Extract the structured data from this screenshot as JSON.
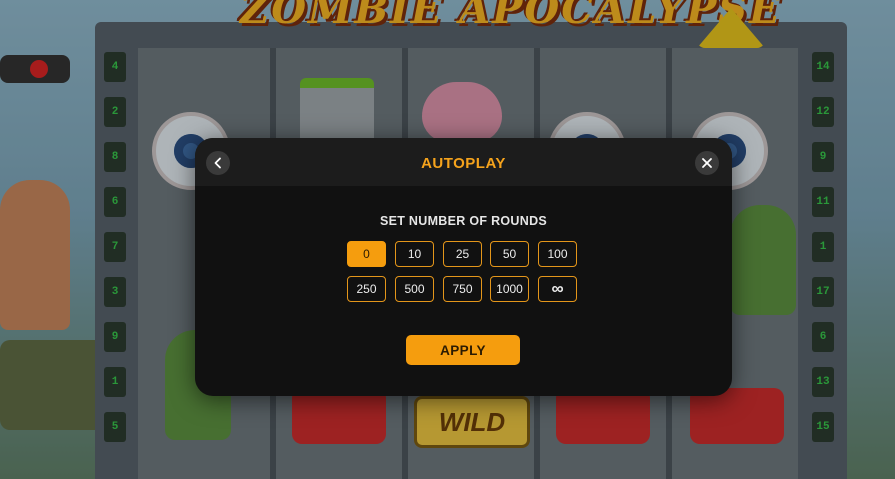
{
  "game": {
    "title_art": "ZOMBIE APOCALYPSE",
    "left_reel_numbers": [
      "4",
      "2",
      "8",
      "6",
      "7",
      "3",
      "9",
      "1",
      "5"
    ],
    "right_reel_numbers": [
      "14",
      "12",
      "9",
      "11",
      "1",
      "17",
      "6",
      "13",
      "15"
    ],
    "wild_label": "WILD"
  },
  "modal": {
    "title": "AUTOPLAY",
    "back_icon": "chevron-left-icon",
    "close_icon": "close-icon",
    "subtitle": "SET NUMBER OF ROUNDS",
    "round_options": [
      "0",
      "10",
      "25",
      "50",
      "100",
      "250",
      "500",
      "750",
      "1000",
      "∞"
    ],
    "selected_option": "0",
    "apply_label": "APPLY"
  },
  "colors": {
    "accent": "#f59d0e",
    "modal_bg": "#111111",
    "modal_header_bg": "#1c1c1c"
  }
}
